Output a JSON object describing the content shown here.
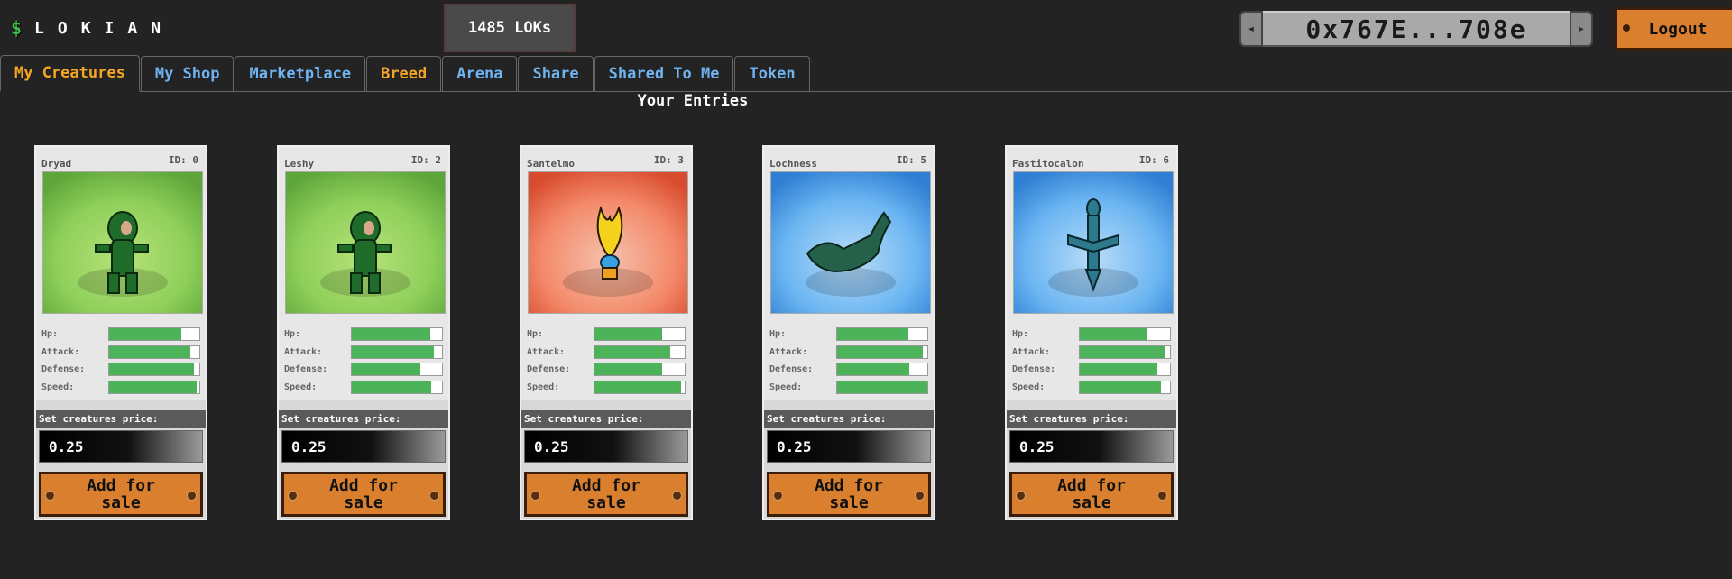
{
  "brand": {
    "icon": "$",
    "name": "LOKIAN"
  },
  "balance": "1485 LOKs",
  "wallet": {
    "address": "0x767E...708e",
    "left_icon": "arrow-left-icon",
    "right_icon": "arrow-right-icon"
  },
  "logout_label": "Logout",
  "tabs": [
    {
      "label": "My Creatures"
    },
    {
      "label": "My Shop"
    },
    {
      "label": "Marketplace"
    },
    {
      "label": "Breed"
    },
    {
      "label": "Arena"
    },
    {
      "label": "Share"
    },
    {
      "label": "Shared To Me"
    },
    {
      "label": "Token"
    }
  ],
  "section_title": "Your Entries",
  "stat_labels": {
    "hp": "Hp:",
    "attack": "Attack:",
    "defense": "Defense:",
    "speed": "Speed:"
  },
  "price_label": "Set creatures price:",
  "add_label": "Add for sale",
  "colors": {
    "accent_orange": "#f5a623",
    "tab_blue": "#6fb3f0",
    "button_orange": "#d97f2e",
    "stat_green": "#4cb35a"
  },
  "creatures": [
    {
      "name": "Dryad",
      "id": "ID: 0",
      "price": "0.25",
      "scene": "forest",
      "stats": {
        "hp": 0.8,
        "attack": 0.9,
        "defense": 0.94,
        "speed": 0.97
      }
    },
    {
      "name": "Leshy",
      "id": "ID: 2",
      "price": "0.25",
      "scene": "forest",
      "stats": {
        "hp": 0.87,
        "attack": 0.91,
        "defense": 0.76,
        "speed": 0.88
      }
    },
    {
      "name": "Santelmo",
      "id": "ID: 3",
      "price": "0.25",
      "scene": "fire",
      "stats": {
        "hp": 0.75,
        "attack": 0.84,
        "defense": 0.75,
        "speed": 0.96
      }
    },
    {
      "name": "Lochness",
      "id": "ID: 5",
      "price": "0.25",
      "scene": "water",
      "stats": {
        "hp": 0.79,
        "attack": 0.95,
        "defense": 0.8,
        "speed": 1.0
      }
    },
    {
      "name": "Fastitocalon",
      "id": "ID: 6",
      "price": "0.25",
      "scene": "water",
      "stats": {
        "hp": 0.74,
        "attack": 0.95,
        "defense": 0.86,
        "speed": 0.9
      }
    }
  ]
}
